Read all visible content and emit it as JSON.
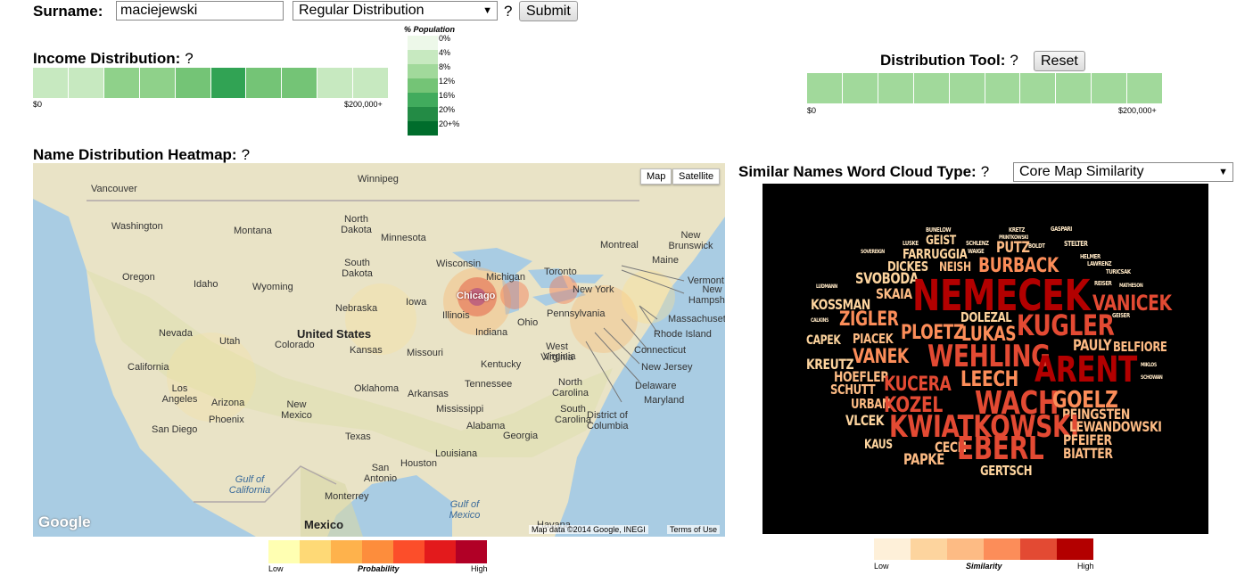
{
  "search": {
    "surname_label": "Surname:",
    "surname_value": "maciejewski",
    "distribution_selected": "Regular Distribution",
    "help": "?",
    "submit_label": "Submit"
  },
  "income": {
    "title": "Income Distribution:",
    "help": "?",
    "min_label": "$0",
    "max_label": "$200,000+",
    "bar_colors": [
      "#c7e9c0",
      "#c7e9c0",
      "#8fd18a",
      "#8fd18a",
      "#74c476",
      "#31a354",
      "#74c476",
      "#74c476",
      "#c7e9c0",
      "#c7e9c0"
    ]
  },
  "population_legend": {
    "title": "% Population",
    "labels": [
      "0%",
      "4%",
      "8%",
      "12%",
      "16%",
      "20%",
      "20+%"
    ],
    "colors": [
      "#edf8e9",
      "#c7e9c0",
      "#a1d99b",
      "#74c476",
      "#41ab5d",
      "#238b45",
      "#006d2c"
    ]
  },
  "tool": {
    "title": "Distribution Tool:",
    "help": "?",
    "reset_label": "Reset",
    "min_label": "$0",
    "max_label": "$200,000+",
    "bar_color": "#a1d99b"
  },
  "heatmap": {
    "title": "Name Distribution Heatmap:",
    "help": "?",
    "map_button": "Map",
    "satellite_button": "Satellite",
    "attribution": "Map data ©2014 Google, INEGI",
    "terms": "Terms of Use",
    "google_logo": "Google",
    "places": [
      "Vancouver",
      "Winnipeg",
      "Washington",
      "Montana",
      "North Dakota",
      "Minnesota",
      "Montreal",
      "New Brunswick",
      "Oregon",
      "Idaho",
      "Wyoming",
      "South Dakota",
      "Wisconsin",
      "Michigan",
      "Toronto",
      "Maine",
      "Vermont",
      "New Hampshire",
      "Chicago",
      "Illinois",
      "Iowa",
      "Nebraska",
      "Ohio",
      "New York",
      "Pennsylvania",
      "Massachusetts",
      "Rhode Island",
      "Nevada",
      "Utah",
      "United States",
      "Colorado",
      "Kansas",
      "Missouri",
      "Indiana",
      "West Virginia",
      "Virginia",
      "Connecticut",
      "New Jersey",
      "California",
      "Kentucky",
      "Delaware",
      "Maryland",
      "Los Angeles",
      "Arizona",
      "Oklahoma",
      "Arkansas",
      "Tennessee",
      "North Carolina",
      "San Diego",
      "Phoenix",
      "New Mexico",
      "Mississippi",
      "South Carolina",
      "District of Columbia",
      "Texas",
      "Alabama",
      "Georgia",
      "Houston",
      "San Antonio",
      "Louisiana",
      "Gulf of California",
      "Monterrey",
      "Gulf of Mexico",
      "Mexico",
      "Havana"
    ],
    "legend_low": "Low",
    "legend_title": "Probability",
    "legend_high": "High",
    "legend_colors": [
      "#ffffb2",
      "#fed976",
      "#feb24c",
      "#fd8d3c",
      "#fc4e2a",
      "#e31a1c",
      "#b10026"
    ]
  },
  "wordcloud": {
    "title": "Similar Names Word Cloud Type:",
    "help": "?",
    "type_selected": "Core Map Similarity",
    "legend_low": "Low",
    "legend_title": "Similarity",
    "legend_high": "High",
    "legend_colors": [
      "#fef0d9",
      "#fdd49e",
      "#fdbb84",
      "#fc8d59",
      "#e34a33",
      "#b30000"
    ],
    "words": [
      "BUNELOW",
      "GEIST",
      "KRETZ",
      "PRINTKOWSKI",
      "GASPARI",
      "SOVEREIGN",
      "LUSKE",
      "FARRUGGIA",
      "SCHLENZ",
      "WAIGE",
      "PUTZ",
      "BOLDT",
      "STELTER",
      "DICKES",
      "NEISH",
      "BURBACK",
      "LAWRENZ",
      "HELMER",
      "TURICSAK",
      "LUDMANN",
      "SVOBODA",
      "NEMECEK",
      "REISER",
      "MATHESON",
      "SKAIA",
      "KOSSMAN",
      "VANICEK",
      "CALKINS",
      "ZIGLER",
      "DOLEZAL",
      "KUGLER",
      "GEISER",
      "CAPEK",
      "PLOETZ",
      "LUKAS",
      "PIACEK",
      "PAULY",
      "BELFIORE",
      "VANEK",
      "WEHLING",
      "ARENT",
      "KREUTZ",
      "HOEFLER",
      "LEECH",
      "MIKLOS",
      "SCHUTT",
      "KUCERA",
      "SCHOWAN",
      "URBAN",
      "KOZEL",
      "WACH",
      "GOELZ",
      "PFINGSTEN",
      "VLCEK",
      "KWIATKOWSKI",
      "LEWANDOWSKI",
      "KAUS",
      "CECH",
      "PFEIFER",
      "EBERL",
      "BIATTER",
      "PAPKE",
      "GERTSCH"
    ]
  }
}
